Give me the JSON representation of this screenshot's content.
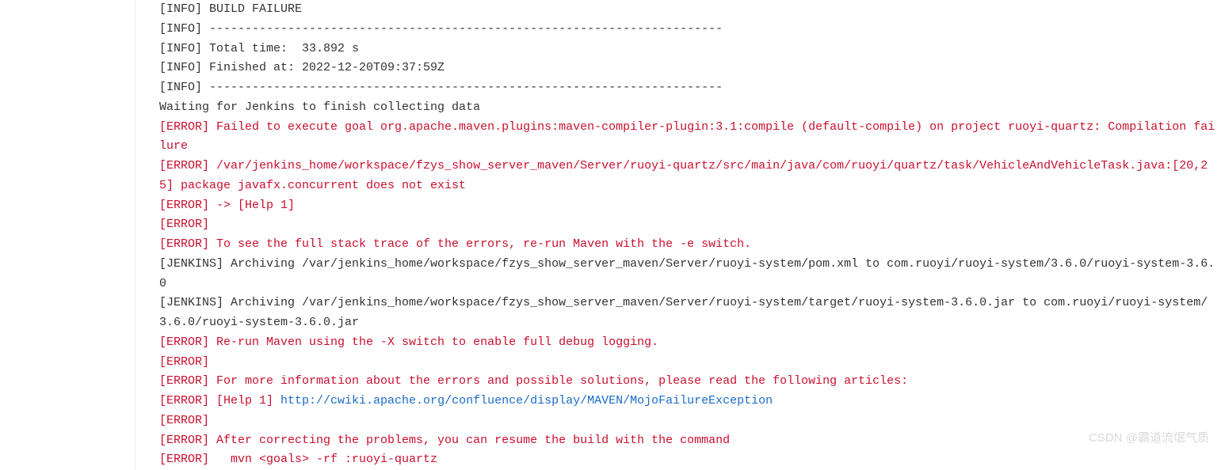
{
  "lines": [
    {
      "cls": "info",
      "text": "[INFO] BUILD FAILURE"
    },
    {
      "cls": "info",
      "text": "[INFO] ------------------------------------------------------------------------"
    },
    {
      "cls": "info",
      "text": "[INFO] Total time:  33.892 s"
    },
    {
      "cls": "info",
      "text": "[INFO] Finished at: 2022-12-20T09:37:59Z"
    },
    {
      "cls": "info",
      "text": "[INFO] ------------------------------------------------------------------------"
    },
    {
      "cls": "normal",
      "text": "Waiting for Jenkins to finish collecting data"
    },
    {
      "cls": "error",
      "text": "[ERROR] Failed to execute goal org.apache.maven.plugins:maven-compiler-plugin:3.1:compile (default-compile) on project ruoyi-quartz: Compilation failure"
    },
    {
      "cls": "error",
      "text": "[ERROR] /var/jenkins_home/workspace/fzys_show_server_maven/Server/ruoyi-quartz/src/main/java/com/ruoyi/quartz/task/VehicleAndVehicleTask.java:[20,25] package javafx.concurrent does not exist"
    },
    {
      "cls": "error",
      "text": "[ERROR] -> [Help 1]"
    },
    {
      "cls": "error",
      "text": "[ERROR] "
    },
    {
      "cls": "error",
      "text": "[ERROR] To see the full stack trace of the errors, re-run Maven with the -e switch."
    },
    {
      "cls": "normal",
      "text": "[JENKINS] Archiving /var/jenkins_home/workspace/fzys_show_server_maven/Server/ruoyi-system/pom.xml to com.ruoyi/ruoyi-system/3.6.0/ruoyi-system-3.6.0"
    },
    {
      "cls": "normal",
      "text": "[JENKINS] Archiving /var/jenkins_home/workspace/fzys_show_server_maven/Server/ruoyi-system/target/ruoyi-system-3.6.0.jar to com.ruoyi/ruoyi-system/3.6.0/ruoyi-system-3.6.0.jar"
    },
    {
      "cls": "error",
      "text": "[ERROR] Re-run Maven using the -X switch to enable full debug logging."
    },
    {
      "cls": "error",
      "text": "[ERROR] "
    },
    {
      "cls": "error",
      "text": "[ERROR] For more information about the errors and possible solutions, please read the following articles:"
    },
    {
      "cls": "error-link",
      "prefix": "[ERROR] [Help 1] ",
      "link": "http://cwiki.apache.org/confluence/display/MAVEN/MojoFailureException"
    },
    {
      "cls": "error",
      "text": "[ERROR] "
    },
    {
      "cls": "error",
      "text": "[ERROR] After correcting the problems, you can resume the build with the command"
    },
    {
      "cls": "error",
      "text": "[ERROR]   mvn <goals> -rf :ruoyi-quartz"
    }
  ],
  "watermark": "CSDN @霸道流氓气质",
  "link_url": "http://cwiki.apache.org/confluence/display/MAVEN/MojoFailureException"
}
